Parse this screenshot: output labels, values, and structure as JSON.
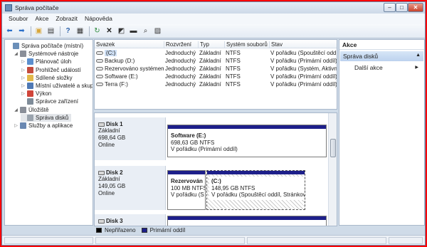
{
  "window": {
    "title": "Správa počítače",
    "min_label": "–",
    "max_label": "□",
    "close_label": "✕"
  },
  "menu": [
    "Soubor",
    "Akce",
    "Zobrazit",
    "Nápověda"
  ],
  "tree": {
    "items": [
      {
        "label": "Správa počítače (místní)",
        "level": 0,
        "icon": "computer-management-icon",
        "color": "#6b8fb8",
        "toggle": ""
      },
      {
        "label": "Systémové nástroje",
        "level": 1,
        "icon": "system-tools-icon",
        "color": "#8a8f99",
        "toggle": "◢"
      },
      {
        "label": "Plánovač úloh",
        "level": 2,
        "icon": "task-scheduler-icon",
        "color": "#5c8fce",
        "toggle": "▷"
      },
      {
        "label": "Prohlížeč událostí",
        "level": 2,
        "icon": "event-viewer-icon",
        "color": "#c44b3d",
        "toggle": "▷"
      },
      {
        "label": "Sdílené složky",
        "level": 2,
        "icon": "shared-folders-icon",
        "color": "#e2b94a",
        "toggle": "▷"
      },
      {
        "label": "Místní uživatelé a skupin",
        "level": 2,
        "icon": "local-users-icon",
        "color": "#4f79b5",
        "toggle": "▷"
      },
      {
        "label": "Výkon",
        "level": 2,
        "icon": "performance-icon",
        "color": "#d0453a",
        "toggle": "▷"
      },
      {
        "label": "Správce zařízení",
        "level": 2,
        "icon": "device-manager-icon",
        "color": "#7f8c99",
        "toggle": ""
      },
      {
        "label": "Úložiště",
        "level": 1,
        "icon": "storage-icon",
        "color": "#8a8f99",
        "toggle": "◢"
      },
      {
        "label": "Správa disků",
        "level": 2,
        "icon": "disk-management-icon",
        "color": "#9aa3ad",
        "toggle": "",
        "selected": true
      },
      {
        "label": "Služby a aplikace",
        "level": 1,
        "icon": "services-apps-icon",
        "color": "#6a88b2",
        "toggle": "▷"
      }
    ]
  },
  "volumes": {
    "headers": [
      "Svazek",
      "Rozvržení",
      "Typ",
      "Systém souborů",
      "Stav"
    ],
    "rows": [
      [
        "(C:)",
        "Jednoduchý",
        "Základní",
        "NTFS",
        "V pořádku (Spouštěcí oddíl"
      ],
      [
        "Backup (D:)",
        "Jednoduchý",
        "Základní",
        "NTFS",
        "V pořádku (Primární oddíl)"
      ],
      [
        "Rezervováno systémem",
        "Jednoduchý",
        "Základní",
        "NTFS",
        "V pořádku (Systém, Aktivní"
      ],
      [
        "Software (E:)",
        "Jednoduchý",
        "Základní",
        "NTFS",
        "V pořádku (Primární oddíl)"
      ],
      [
        "Terra (F:)",
        "Jednoduchý",
        "Základní",
        "NTFS",
        "V pořádku (Primární oddíl)"
      ]
    ]
  },
  "disks": [
    {
      "name": "Disk 1",
      "type": "Základní",
      "size": "698,64 GB",
      "status": "Online",
      "partitions": [
        {
          "name": "Software  (E:)",
          "detail": "698,63 GB NTFS",
          "status": "V pořádku (Primární oddíl)"
        }
      ]
    },
    {
      "name": "Disk 2",
      "type": "Základní",
      "size": "149,05 GB",
      "status": "Online",
      "partitions": [
        {
          "name": "Rezervován",
          "detail": "100 MB NTFS",
          "status": "V pořádku (S"
        },
        {
          "name": "(C:)",
          "detail": "148,95 GB NTFS",
          "status": "V pořádku (Spouštěcí oddíl, Stránková"
        }
      ]
    },
    {
      "name": "Disk 3"
    }
  ],
  "legend": [
    {
      "label": "Nepřiřazeno",
      "color": "#000000"
    },
    {
      "label": "Primární oddíl",
      "color": "#1d1f8a"
    }
  ],
  "actions": {
    "title": "Akce",
    "selected": "Správa disků",
    "more": "Další akce",
    "more_arrow": "▶",
    "collapse_arrow": "▲"
  },
  "colors": {
    "accent": "#1d1f8a",
    "selection": "#cfe0f5"
  }
}
